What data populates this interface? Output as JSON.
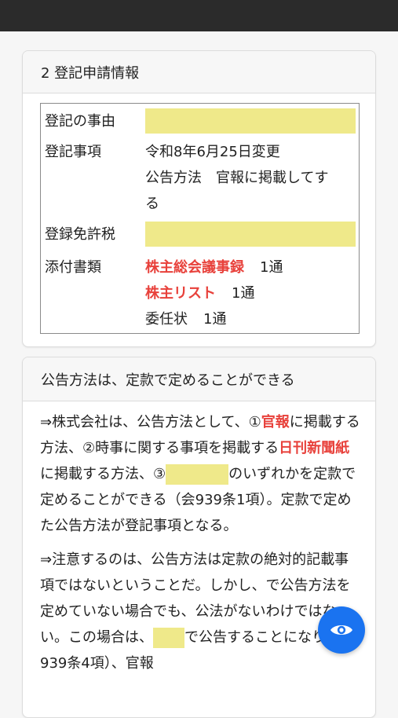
{
  "card1": {
    "title": "2 登記申請情報",
    "rows": [
      {
        "label": "登記の事由",
        "value": ""
      },
      {
        "label": "登記事項",
        "lines": [
          "令和8年6月25日変更",
          "公告方法　官報に掲載してす",
          "る"
        ]
      },
      {
        "label": "登録免許税",
        "value": ""
      },
      {
        "label": "添付書類",
        "items": [
          {
            "name": "株主総会議事録",
            "count": "1通"
          },
          {
            "name": "株主リスト",
            "count": "1通"
          },
          {
            "name": "委任状",
            "count": "1通"
          }
        ]
      }
    ]
  },
  "card2": {
    "title": "公告方法は、定款で定めることができる",
    "p1": {
      "a": "⇒株式会社は、公告方法として、①",
      "b": "官報",
      "c": "に掲載する方法、②時事に関する事項を掲載する",
      "d": "日刊新聞紙",
      "e": "に掲載する方法、③",
      "f": "のいずれかを定款で定めることができる（会939条1項）。定款で定めた公告方法が登記事項となる。"
    },
    "p2": {
      "a": "⇒注意するのは、公告方法は定款の絶対的記載事項ではないということだ。しかし、",
      "b": "で公告方法を定めていない場合でも、公",
      "c": "法がないわけではない。この場合は、",
      "d": "で公告することになり（会939条4項）、官報"
    }
  },
  "colors": {
    "highlight": "#efe98a",
    "accent_red": "#e8413b",
    "fab_blue": "#1a73f0"
  },
  "fab": {
    "icon": "eye-icon"
  }
}
